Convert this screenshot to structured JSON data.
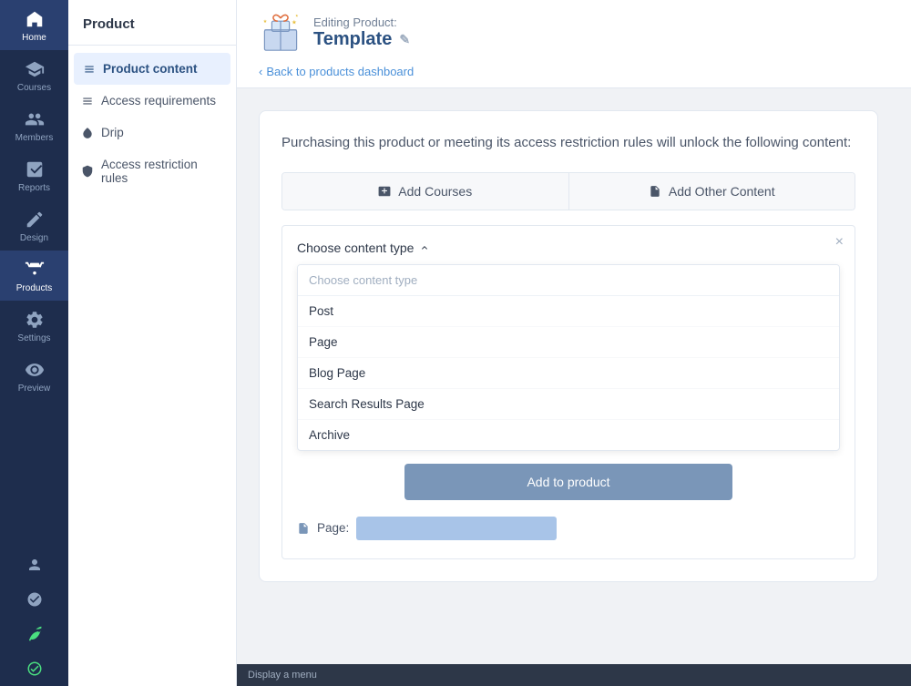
{
  "iconBar": {
    "items": [
      {
        "label": "Home",
        "active": false,
        "name": "home"
      },
      {
        "label": "Courses",
        "active": false,
        "name": "courses"
      },
      {
        "label": "Members",
        "active": false,
        "name": "members"
      },
      {
        "label": "Reports",
        "active": false,
        "name": "reports"
      },
      {
        "label": "Design",
        "active": false,
        "name": "design"
      },
      {
        "label": "Products",
        "active": true,
        "name": "products"
      },
      {
        "label": "Settings",
        "active": false,
        "name": "settings"
      },
      {
        "label": "Preview",
        "active": false,
        "name": "preview"
      }
    ]
  },
  "sidebar": {
    "title": "Product",
    "navItems": [
      {
        "label": "Product content",
        "active": true,
        "name": "product-content"
      },
      {
        "label": "Access requirements",
        "active": false,
        "name": "access-requirements"
      },
      {
        "label": "Drip",
        "active": false,
        "name": "drip"
      },
      {
        "label": "Access restriction rules",
        "active": false,
        "name": "access-restriction-rules"
      }
    ]
  },
  "header": {
    "editingLabel": "Editing Product:",
    "templateName": "Template",
    "backLink": "Back to products dashboard"
  },
  "main": {
    "description": "Purchasing this product or meeting its access restriction rules will unlock the following content:",
    "addCoursesBtn": "Add Courses",
    "addOtherContentBtn": "Add Other Content",
    "chooseContentType": "Choose content type",
    "closeBtn": "×",
    "dropdownPlaceholder": "Choose content type",
    "dropdownItems": [
      "Post",
      "Page",
      "Blog Page",
      "Search Results Page",
      "Archive"
    ],
    "addToProductBtn": "Add to product",
    "pageLabel": "Page:"
  },
  "bottomBar": {
    "label": "Display a menu"
  }
}
